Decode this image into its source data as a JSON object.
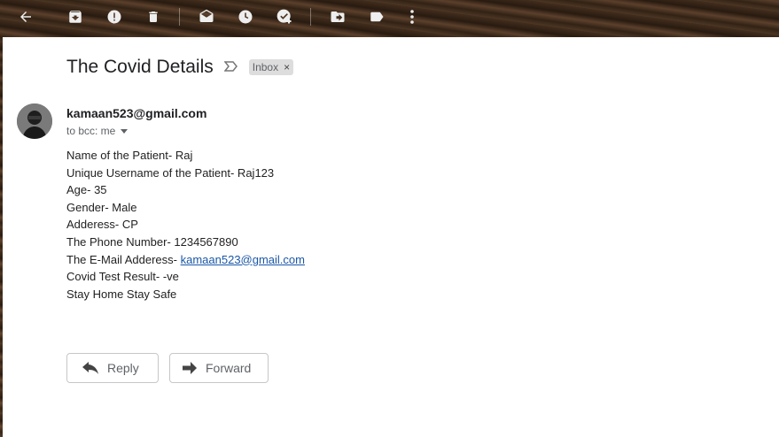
{
  "toolbar": {
    "icons": [
      "back-arrow-icon",
      "archive-icon",
      "report-spam-icon",
      "delete-icon",
      "mark-unread-icon",
      "snooze-icon",
      "add-to-tasks-icon",
      "move-to-icon",
      "labels-icon",
      "more-icon"
    ]
  },
  "email": {
    "subject": "The Covid Details",
    "label": "Inbox",
    "label_remove": "×",
    "sender": "kamaan523@gmail.com",
    "recipient": "to bcc: me",
    "lines": [
      "Name of the Patient- Raj",
      "Unique Username of the Patient- Raj123",
      "Age- 35",
      "Gender- Male",
      "Adderess- CP",
      "The Phone Number- 1234567890"
    ],
    "email_line_prefix": "The E-Mail Adderess- ",
    "email_link": "kamaan523@gmail.com",
    "lines_after": [
      "Covid Test Result- -ve",
      "Stay Home Stay Safe"
    ]
  },
  "actions": {
    "reply": "Reply",
    "forward": "Forward"
  }
}
